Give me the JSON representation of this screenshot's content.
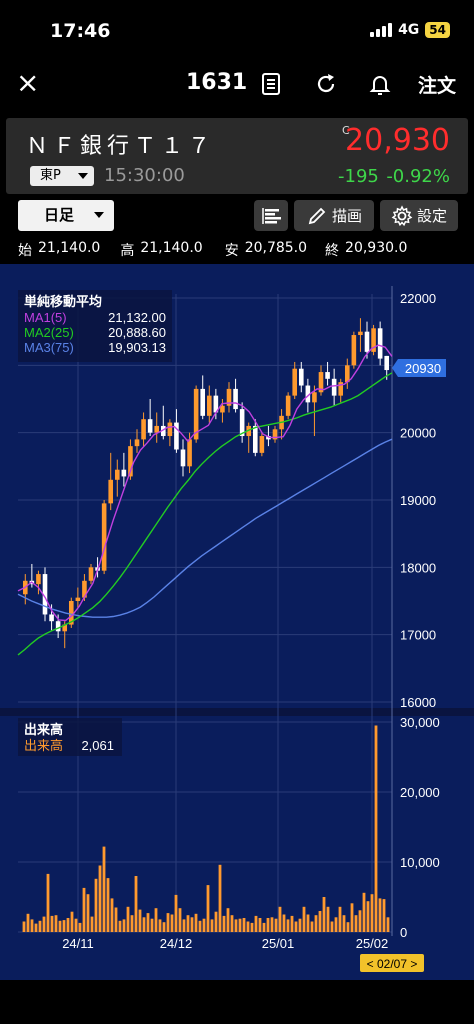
{
  "status_bar": {
    "time": "17:46",
    "network": "4G",
    "battery": "54"
  },
  "nav": {
    "close": "×",
    "code": "1631",
    "order_label": "注文"
  },
  "quote": {
    "name": "ＮＦ銀行Ｔ１７",
    "market": "東P",
    "time": "15:30:00",
    "c_mark": "C",
    "price": "20,930",
    "change": "-195",
    "change_pct": "-0.92%"
  },
  "toolbar": {
    "period": "日足",
    "draw_label": "描画",
    "settings_label": "設定"
  },
  "ohlc": {
    "open_label": "始",
    "open": "21,140.0",
    "high_label": "高",
    "high": "21,140.0",
    "low_label": "安",
    "low": "20,785.0",
    "close_label": "終",
    "close": "20,930.0"
  },
  "colors": {
    "chart_bg": "#0a1d5c",
    "up": "#ff9a2e",
    "down": "#ffffff",
    "ma1": "#c040e0",
    "ma2": "#22cc22",
    "ma3": "#5a82e6",
    "volume": "#ff9a2e",
    "price_tag": "#2f6fe0",
    "date_tag": "#f2c22a",
    "price_up": "#ff2d2d",
    "price_down": "#3ed64a"
  },
  "chart_data": [
    {
      "type": "candlestick",
      "title": "単純移動平均",
      "legend": [
        {
          "name": "MA1(5)",
          "value": "21,132.00"
        },
        {
          "name": "MA2(25)",
          "value": "20,888.60"
        },
        {
          "name": "MA3(75)",
          "value": "19,903.13"
        }
      ],
      "y_ticks": [
        "22000",
        "21000",
        "20000",
        "19000",
        "18000",
        "17000",
        "16000"
      ],
      "ylim": [
        16000,
        22000
      ],
      "x_ticks": [
        "24/11",
        "24/12",
        "25/01",
        "25/02"
      ],
      "last_price_tag": "20930",
      "date_tag": "< 02/07 >",
      "candles": [
        [
          17600,
          17900,
          17450,
          17800
        ],
        [
          17800,
          18050,
          17700,
          17750
        ],
        [
          17750,
          17950,
          17600,
          17900
        ],
        [
          17900,
          18000,
          17200,
          17300
        ],
        [
          17300,
          17450,
          17050,
          17200
        ],
        [
          17200,
          17300,
          16950,
          17050
        ],
        [
          17050,
          17200,
          16800,
          17150
        ],
        [
          17150,
          17550,
          17100,
          17500
        ],
        [
          17500,
          17700,
          17400,
          17550
        ],
        [
          17550,
          17900,
          17500,
          17800
        ],
        [
          17800,
          18050,
          17750,
          18000
        ],
        [
          18000,
          18150,
          17850,
          17950
        ],
        [
          17950,
          19000,
          17900,
          18950
        ],
        [
          18950,
          19700,
          18850,
          19300
        ],
        [
          19300,
          19600,
          19050,
          19450
        ],
        [
          19450,
          19700,
          19200,
          19350
        ],
        [
          19350,
          19900,
          19300,
          19800
        ],
        [
          19800,
          20050,
          19700,
          19900
        ],
        [
          19900,
          20300,
          19800,
          20200
        ],
        [
          20200,
          20500,
          19950,
          20000
        ],
        [
          20000,
          20300,
          19850,
          20100
        ],
        [
          20100,
          20400,
          19900,
          19950
        ],
        [
          19950,
          20200,
          19800,
          20150
        ],
        [
          20150,
          20350,
          19700,
          19750
        ],
        [
          19750,
          19900,
          19350,
          19500
        ],
        [
          19500,
          20000,
          19400,
          19900
        ],
        [
          19900,
          20700,
          19850,
          20650
        ],
        [
          20650,
          20850,
          20200,
          20250
        ],
        [
          20250,
          20700,
          20150,
          20550
        ],
        [
          20550,
          20650,
          20200,
          20300
        ],
        [
          20300,
          20500,
          20150,
          20400
        ],
        [
          20400,
          20750,
          20300,
          20650
        ],
        [
          20650,
          20800,
          20300,
          20350
        ],
        [
          20350,
          20450,
          19850,
          19950
        ],
        [
          19950,
          20150,
          19700,
          20100
        ],
        [
          20100,
          20200,
          19650,
          19700
        ],
        [
          19700,
          20000,
          19650,
          19950
        ],
        [
          19950,
          20100,
          19800,
          19900
        ],
        [
          19900,
          20100,
          19850,
          20050
        ],
        [
          20050,
          20350,
          19900,
          20250
        ],
        [
          20250,
          20600,
          20200,
          20550
        ],
        [
          20550,
          21050,
          20500,
          20950
        ],
        [
          20950,
          21050,
          20600,
          20700
        ],
        [
          20700,
          20800,
          20300,
          20450
        ],
        [
          20450,
          20700,
          19950,
          20600
        ],
        [
          20600,
          21000,
          20550,
          20900
        ],
        [
          20900,
          21050,
          20700,
          20800
        ],
        [
          20800,
          20950,
          20400,
          20550
        ],
        [
          20550,
          20800,
          20450,
          20750
        ],
        [
          20750,
          21100,
          20650,
          21000
        ],
        [
          21000,
          21500,
          20950,
          21450
        ],
        [
          21450,
          21700,
          21200,
          21500
        ],
        [
          21500,
          21650,
          21100,
          21200
        ],
        [
          21200,
          21600,
          21150,
          21550
        ],
        [
          21550,
          21650,
          21000,
          21100
        ],
        [
          21140,
          21140,
          20785,
          20930
        ]
      ],
      "ma1": [
        17650,
        17700,
        17780,
        17700,
        17550,
        17350,
        17220,
        17210,
        17290,
        17420,
        17600,
        17760,
        18050,
        18380,
        18700,
        18990,
        19280,
        19560,
        19740,
        19850,
        19970,
        20020,
        20080,
        20090,
        19990,
        19870,
        19990,
        20050,
        20110,
        20280,
        20430,
        20440,
        20440,
        20400,
        20310,
        20150,
        19980,
        19930,
        19930,
        19940,
        20110,
        20350,
        20490,
        20580,
        20650,
        20640,
        20690,
        20700,
        20720,
        20800,
        20950,
        21130,
        21250,
        21300,
        21270,
        21132
      ],
      "ma2": [
        16700,
        16780,
        16870,
        16950,
        17010,
        17060,
        17100,
        17150,
        17200,
        17260,
        17330,
        17400,
        17490,
        17600,
        17720,
        17850,
        17990,
        18140,
        18290,
        18440,
        18590,
        18740,
        18890,
        19030,
        19170,
        19290,
        19420,
        19530,
        19630,
        19720,
        19800,
        19870,
        19940,
        19990,
        20040,
        20080,
        20100,
        20120,
        20140,
        20160,
        20190,
        20220,
        20260,
        20290,
        20320,
        20350,
        20380,
        20420,
        20460,
        20500,
        20550,
        20620,
        20690,
        20760,
        20830,
        20889
      ],
      "ma3": [
        17600,
        17550,
        17500,
        17460,
        17420,
        17380,
        17350,
        17320,
        17300,
        17280,
        17270,
        17260,
        17260,
        17260,
        17270,
        17290,
        17320,
        17360,
        17410,
        17480,
        17560,
        17650,
        17740,
        17830,
        17920,
        18010,
        18090,
        18170,
        18240,
        18310,
        18380,
        18450,
        18520,
        18590,
        18660,
        18730,
        18790,
        18850,
        18910,
        18970,
        19030,
        19090,
        19150,
        19210,
        19270,
        19330,
        19390,
        19450,
        19510,
        19570,
        19630,
        19690,
        19750,
        19810,
        19860,
        19903
      ]
    },
    {
      "type": "bar",
      "title": "出来高",
      "legend": [
        {
          "name": "出来高",
          "value": "2,061"
        }
      ],
      "y_ticks": [
        "30,000",
        "20,000",
        "10,000",
        "0"
      ],
      "ylim": [
        0,
        30000
      ],
      "values": [
        1500,
        2600,
        1800,
        1200,
        1600,
        2200,
        8300,
        2300,
        2400,
        1600,
        1700,
        2000,
        2900,
        1900,
        1300,
        6300,
        5400,
        2200,
        7600,
        9500,
        12200,
        7700,
        4800,
        3500,
        1600,
        1800,
        3600,
        2400,
        8000,
        3200,
        2100,
        2700,
        1900,
        3400,
        1800,
        1400,
        2700,
        2500,
        5300,
        3400,
        1800,
        2400,
        2100,
        2600,
        1600,
        1900,
        6700,
        1800,
        2900,
        9600,
        2300,
        3400,
        2400,
        1800,
        1900,
        2000,
        1500,
        1300,
        2300,
        2000,
        1300,
        2000,
        2100,
        1900,
        3600,
        2500,
        1800,
        2300,
        1500,
        1900,
        3600,
        2500,
        1500,
        2400,
        3000,
        5000,
        3600,
        1500,
        2100,
        3600,
        2400,
        1400,
        4100,
        2400,
        3100,
        5600,
        4400,
        5400,
        29500,
        4800,
        4700,
        2100
      ]
    }
  ]
}
